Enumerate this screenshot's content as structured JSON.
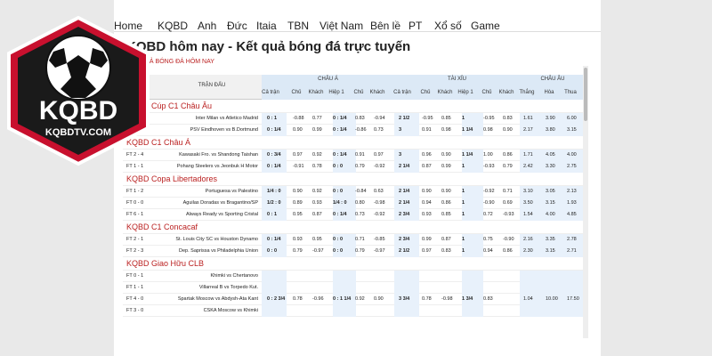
{
  "nav": {
    "items": [
      "Home",
      "KQBD",
      "Anh",
      "Đức",
      "Itaia",
      "TBN",
      "Việt Nam",
      "Bên lề",
      "PT",
      "Xổ số",
      "Game"
    ]
  },
  "title": "KQBD hôm nay - Kết quả bóng đá trực tuyến",
  "breadcrumb": "KẾT QUẢ BÓNG ĐÁ HÔM NAY",
  "logo": {
    "text": "KQBD",
    "sub": "KQBDTV.COM"
  },
  "table": {
    "group_chau_a": "CHÂU Á",
    "group_tai_xiu": "TÀI XỈU",
    "group_chau_au": "CHÂU ÂU",
    "col_tran_dau": "TRẬN ĐẤU",
    "sub_headers_a": [
      "Cả trận",
      "Chủ",
      "Khách",
      "Hiệp 1",
      "Chủ",
      "Khách"
    ],
    "sub_headers_tx": [
      "Cả trận",
      "Chủ",
      "Khách",
      "Hiệp 1",
      "Chủ",
      "Khách"
    ],
    "sub_headers_eu": [
      "Thắng",
      "Hòa",
      "Thua"
    ],
    "leagues": [
      {
        "name": "KQBD Cúp C1 Châu Âu",
        "matches": [
          {
            "ft": "",
            "match": "Inter Milan vs Atletico Madrid",
            "a": [
              "0 : 1",
              "-0.88",
              "0.77",
              "0 : 1/4",
              "0.83",
              "-0.94"
            ],
            "tx": [
              "2 1/2",
              "-0.95",
              "0.85",
              "1",
              "-0.95",
              "0.83"
            ],
            "eu": [
              "1.61",
              "3.90",
              "6.00"
            ]
          },
          {
            "ft": "FT 1 -",
            "match": "PSV Eindhoven vs B.Dortmund",
            "a": [
              "0 : 1/4",
              "0.90",
              "0.99",
              "0 : 1/4",
              "-0.86",
              "0.73"
            ],
            "tx": [
              "3",
              "0.91",
              "0.98",
              "1 1/4",
              "0.98",
              "0.90"
            ],
            "eu": [
              "2.17",
              "3.80",
              "3.15"
            ]
          }
        ]
      },
      {
        "name": "KQBD C1 Châu Á",
        "matches": [
          {
            "ft": "FT 2 - 4",
            "match": "Kawasaki Fro. vs Shandong Taishan",
            "a": [
              "0 : 3/4",
              "0.97",
              "0.92",
              "0 : 1/4",
              "0.91",
              "0.97"
            ],
            "tx": [
              "3",
              "0.96",
              "0.90",
              "1 1/4",
              "1.00",
              "0.86"
            ],
            "eu": [
              "1.71",
              "4.05",
              "4.00"
            ]
          },
          {
            "ft": "FT 1 - 1",
            "match": "Pohang Steelers vs Jeonbuk H Motor",
            "a": [
              "0 : 1/4",
              "-0.91",
              "0.78",
              "0 : 0",
              "0.79",
              "-0.92"
            ],
            "tx": [
              "2 1/4",
              "0.87",
              "0.99",
              "1",
              "-0.93",
              "0.79"
            ],
            "eu": [
              "2.42",
              "3.30",
              "2.75"
            ]
          }
        ]
      },
      {
        "name": "KQBD Copa Libertadores",
        "matches": [
          {
            "ft": "FT 1 - 2",
            "match": "Portuguesa vs Palestino",
            "a": [
              "1/4 : 0",
              "0.90",
              "0.92",
              "0 : 0",
              "-0.84",
              "0.63"
            ],
            "tx": [
              "2 1/4",
              "0.90",
              "0.90",
              "1",
              "-0.92",
              "0.71"
            ],
            "eu": [
              "3.10",
              "3.05",
              "2.13"
            ]
          },
          {
            "ft": "FT 0 - 0",
            "match": "Aguilas Doradas vs Bragantino/SP",
            "a": [
              "1/2 : 0",
              "0.89",
              "0.93",
              "1/4 : 0",
              "0.80",
              "-0.98"
            ],
            "tx": [
              "2 1/4",
              "0.94",
              "0.86",
              "1",
              "-0.90",
              "0.69"
            ],
            "eu": [
              "3.50",
              "3.15",
              "1.93"
            ]
          },
          {
            "ft": "FT 6 - 1",
            "match": "Always Ready vs Sporting Cristal",
            "a": [
              "0 : 1",
              "0.95",
              "0.87",
              "0 : 1/4",
              "0.73",
              "-0.92"
            ],
            "tx": [
              "2 3/4",
              "0.93",
              "0.85",
              "1",
              "0.72",
              "-0.93"
            ],
            "eu": [
              "1.54",
              "4.00",
              "4.85"
            ]
          }
        ]
      },
      {
        "name": "KQBD C1 Concacaf",
        "matches": [
          {
            "ft": "FT 2 - 1",
            "match": "St. Louis City SC vs Houston Dynamo",
            "a": [
              "0 : 1/4",
              "0.93",
              "0.95",
              "0 : 0",
              "0.71",
              "-0.85"
            ],
            "tx": [
              "2 3/4",
              "0.99",
              "0.87",
              "1",
              "0.75",
              "-0.90"
            ],
            "eu": [
              "2.16",
              "3.35",
              "2.78"
            ]
          },
          {
            "ft": "FT 2 - 3",
            "match": "Dep. Saprissa vs Philadelphia Union",
            "a": [
              "0 : 0",
              "0.79",
              "-0.97",
              "0 : 0",
              "0.79",
              "-0.97"
            ],
            "tx": [
              "2 1/2",
              "0.97",
              "0.83",
              "1",
              "0.94",
              "0.86"
            ],
            "eu": [
              "2.30",
              "3.15",
              "2.71"
            ]
          }
        ]
      },
      {
        "name": "KQBD Giao Hữu CLB",
        "matches": [
          {
            "ft": "FT 0 - 1",
            "match": "Khimki vs Chertanovo",
            "a": [
              "",
              "",
              "",
              "",
              "",
              ""
            ],
            "tx": [
              "",
              "",
              "",
              "",
              "",
              ""
            ],
            "eu": [
              "",
              "",
              ""
            ]
          },
          {
            "ft": "FT 1 - 1",
            "match": "Villarreal B vs Torpedo Kut.",
            "a": [
              "",
              "",
              "",
              "",
              "",
              ""
            ],
            "tx": [
              "",
              "",
              "",
              "",
              "",
              ""
            ],
            "eu": [
              "",
              "",
              ""
            ]
          },
          {
            "ft": "FT 4 - 0",
            "match": "Spartak Moscow vs Abdysh-Ata Kant",
            "a": [
              "0 : 2 3/4",
              "0.78",
              "-0.96",
              "0 : 1 1/4",
              "0.92",
              "0.90"
            ],
            "tx": [
              "3 3/4",
              "0.78",
              "-0.98",
              "1 3/4",
              "0.83",
              ""
            ],
            "eu": [
              "1.04",
              "10.00",
              "17.50"
            ]
          },
          {
            "ft": "FT 3 - 0",
            "match": "CSKA Moscow vs Khimki",
            "a": [
              "",
              "",
              "",
              "",
              "",
              ""
            ],
            "tx": [
              "",
              "",
              "",
              "",
              "",
              ""
            ],
            "eu": [
              "",
              "",
              ""
            ]
          }
        ]
      }
    ]
  }
}
